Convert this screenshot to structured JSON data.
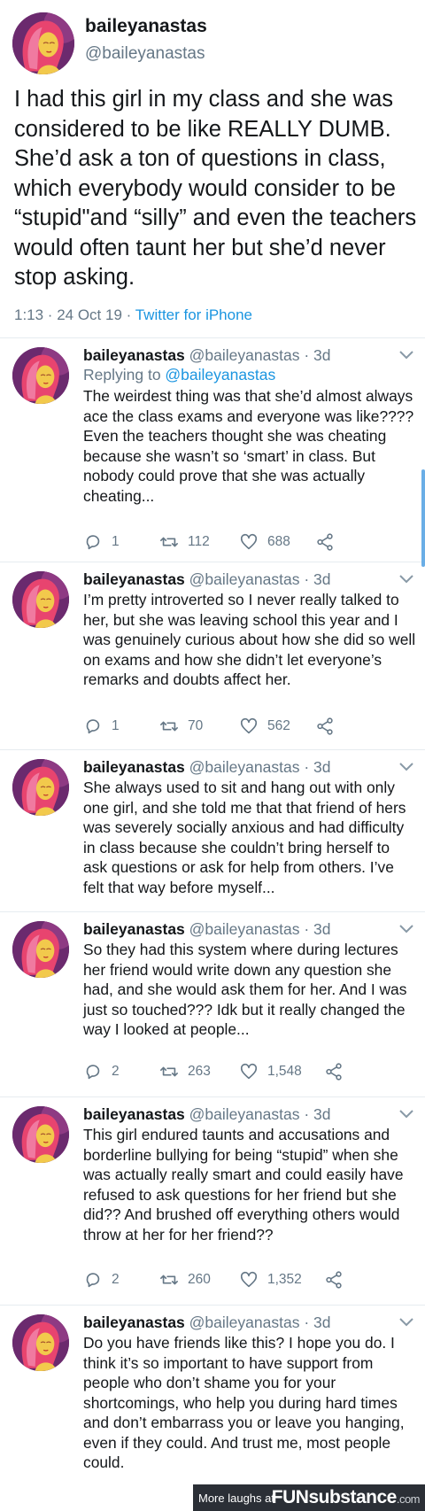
{
  "main_tweet": {
    "display_name": "baileyanastas",
    "handle": "@baileyanastas",
    "text": "I had this girl in my class and she was considered to be like REALLY DUMB. She’d ask a ton of questions in class, which everybody would consider to be “stupid\"and “silly” and even the teachers would often taunt her but she’d never stop asking.",
    "timestamp": "1:13 · 24 Oct 19 · ",
    "source": "Twitter for iPhone"
  },
  "replies": [
    {
      "name": "baileyanastas",
      "handle": "@baileyanastas · 3d",
      "replying_label": "Replying to ",
      "replying_to": "@baileyanastas",
      "text": "The weirdest thing was that she’d almost always ace the class exams and everyone was like???? Even the teachers thought she was cheating because she wasn’t so ‘smart’ in class. But nobody could prove that she was actually cheating...",
      "replies": "1",
      "retweets": "112",
      "likes": "688"
    },
    {
      "name": "baileyanastas",
      "handle": "@baileyanastas · 3d",
      "text": "I’m pretty introverted so I never really talked to her, but she was leaving school this year and I was genuinely curious about how she did so well on exams and how she didn’t let everyone’s remarks and doubts affect her.",
      "replies": "1",
      "retweets": "70",
      "likes": "562"
    },
    {
      "name": "baileyanastas",
      "handle": "@baileyanastas · 3d",
      "text": "She always used to sit and hang out with only one girl, and she told me that that friend of hers was severely socially anxious and had difficulty in class because she couldn’t bring herself to ask questions or ask for help from others. I’ve felt that way before myself..."
    },
    {
      "name": "baileyanastas",
      "handle": "@baileyanastas · 3d",
      "text": "So they had this system where during lectures her friend would write down any question she had, and she would ask them for her. And I was just so touched??? Idk but it really changed the way I looked at people...",
      "replies": "2",
      "retweets": "263",
      "likes": "1,548"
    },
    {
      "name": "baileyanastas",
      "handle": "@baileyanastas · 3d",
      "text": "This girl endured taunts and accusations and borderline bullying for being “stupid” when she was actually really smart and could easily have refused to ask questions for her friend but she did?? And brushed off everything others would throw at her for her friend??",
      "replies": "2",
      "retweets": "260",
      "likes": "1,352"
    },
    {
      "name": "baileyanastas",
      "handle": "@baileyanastas · 3d",
      "text": "Do you have friends like this? I hope you do. I think it’s so important to have support from people who don’t shame you for your shortcomings, who help you during hard times and don’t embarrass you or leave you hanging, even if they could. And trust me, most people could."
    }
  ],
  "footer": {
    "more_label": "More laughs at",
    "brand": "FUNsubstance",
    "brand_suffix": ".com"
  },
  "colors": {
    "link": "#1b95e0",
    "muted": "#657786",
    "text": "#14171a",
    "avatar_bg": "#6b2a6e",
    "hair": "#e8446f",
    "face": "#f2c94c"
  }
}
